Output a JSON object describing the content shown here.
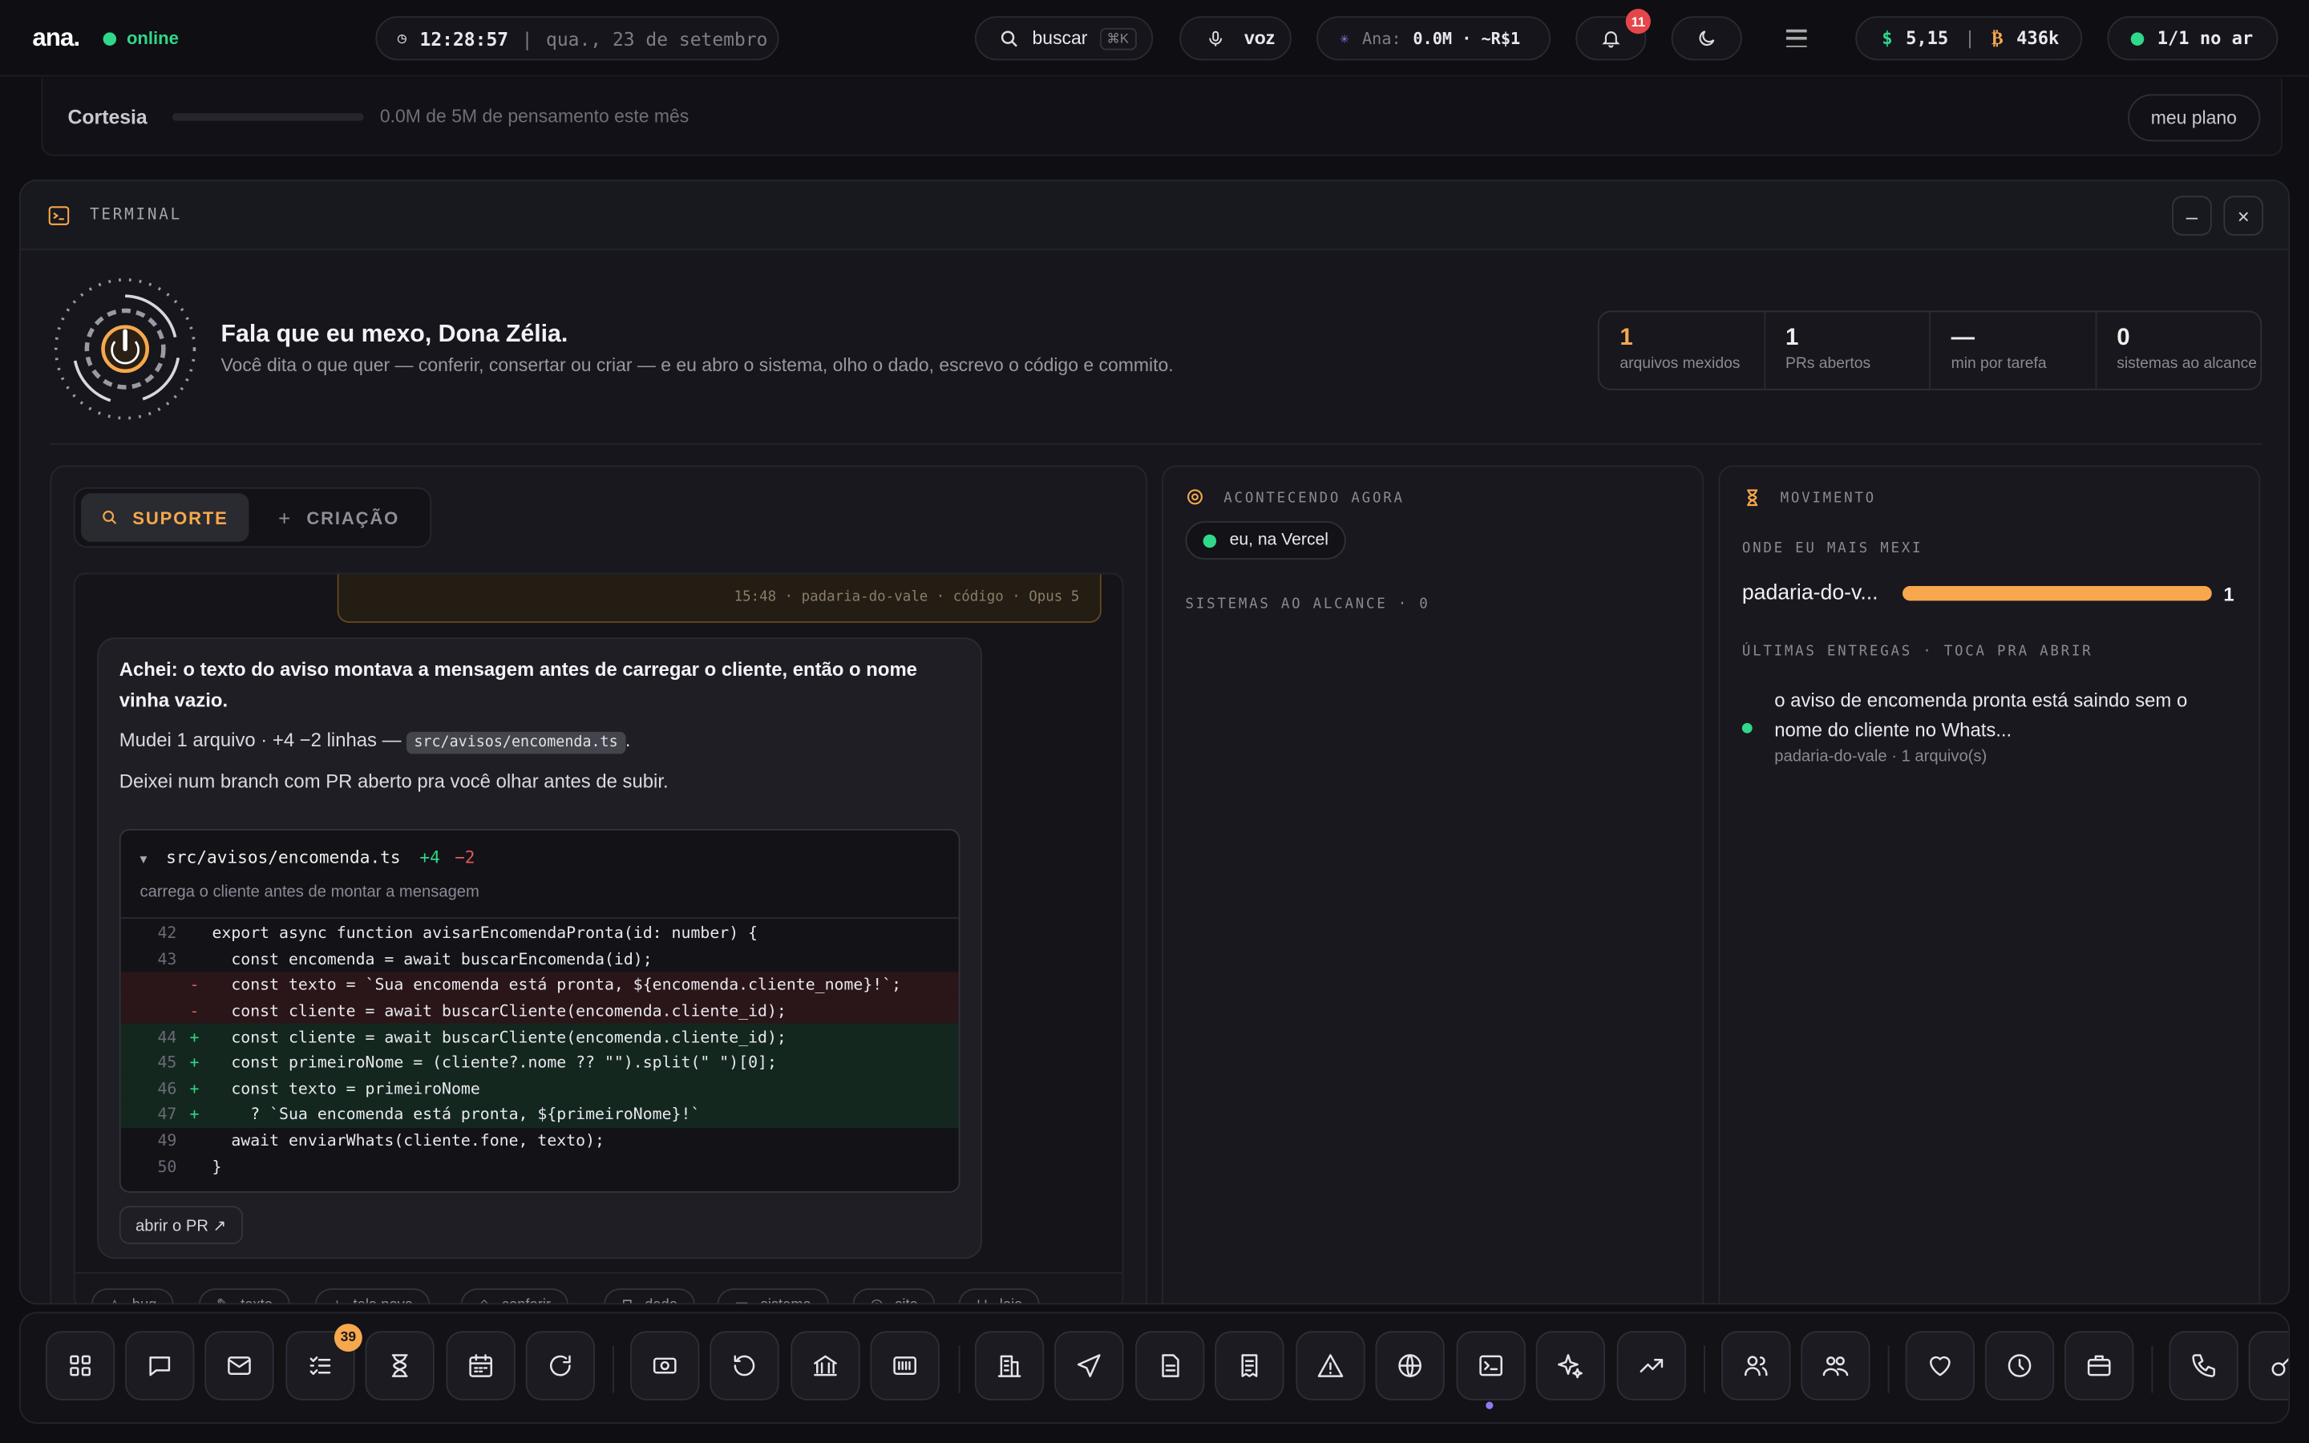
{
  "app": {
    "logo": "ana.",
    "status": "online"
  },
  "topbar": {
    "time": "12:28:57",
    "date_sep": "|",
    "date": "qua., 23 de setembro",
    "search_label": "buscar",
    "search_kbd": "⌘K",
    "voice_label": "voz",
    "usage_name": "Ana:",
    "usage_value": "0.0M · ~R$1",
    "notifications_count": "11",
    "balance_usd": "5,15",
    "balance_sep": "|",
    "balance_btc": "436k",
    "live_label": "1/1 no ar",
    "usd_symbol": "$",
    "btc_symbol": "₿"
  },
  "plan": {
    "name": "Cortesia",
    "usage_text": "0.0M de 5M de pensamento este mês",
    "usage_fraction": 0.0,
    "button": "meu plano"
  },
  "terminal": {
    "title": "TERMINAL",
    "minimize": "–",
    "close": "×",
    "hero_title": "Fala que eu mexo, Dona Zélia.",
    "hero_sub": "Você dita o que quer — conferir, consertar ou criar — e eu abro o sistema, olho o dado, escrevo o código e commito.",
    "stats": [
      {
        "value": "1",
        "label": "arquivos mexidos"
      },
      {
        "value": "1",
        "label": "PRs abertos"
      },
      {
        "value": "—",
        "label": "min por tarefa"
      },
      {
        "value": "0",
        "label": "sistemas ao alcance"
      }
    ],
    "tabs": {
      "support": "SUPORTE",
      "create": "CRIAÇÃO"
    },
    "prev_meta": "15:48 · padaria-do-vale · código · Opus 5",
    "reply": {
      "headline": "Achei: o texto do aviso montava a mensagem antes de carregar o cliente, então o nome vinha vazio.",
      "changed_prefix": "Mudei 1 arquivo · +4 −2 linhas —",
      "changed_file": "src/avisos/encomenda.ts",
      "changed_suffix": ".",
      "branch_note": "Deixei num branch com PR aberto pra você olhar antes de subir.",
      "diff": {
        "file": "src/avisos/encomenda.ts",
        "added": "+4",
        "removed": "−2",
        "description": "carrega o cliente antes de montar a mensagem",
        "lines": [
          {
            "n": "42",
            "s": "",
            "code": "export async function avisarEncomendaPronta(id: number) {",
            "kind": "ctx"
          },
          {
            "n": "43",
            "s": "",
            "code": "  const encomenda = await buscarEncomenda(id);",
            "kind": "ctx"
          },
          {
            "n": "",
            "s": "-",
            "code": "  const texto = `Sua encomenda está pronta, ${encomenda.cliente_nome}!`;",
            "kind": "del"
          },
          {
            "n": "",
            "s": "-",
            "code": "  const cliente = await buscarCliente(encomenda.cliente_id);",
            "kind": "del"
          },
          {
            "n": "44",
            "s": "+",
            "code": "  const cliente = await buscarCliente(encomenda.cliente_id);",
            "kind": "add"
          },
          {
            "n": "45",
            "s": "+",
            "code": "  const primeiroNome = (cliente?.nome ?? \"\").split(\" \")[0];",
            "kind": "add"
          },
          {
            "n": "46",
            "s": "+",
            "code": "  const texto = primeiroNome",
            "kind": "add"
          },
          {
            "n": "47",
            "s": "+",
            "code": "    ? `Sua encomenda está pronta, ${primeiroNome}!`",
            "kind": "add"
          },
          {
            "n": "49",
            "s": "",
            "code": "  await enviarWhats(cliente.fone, texto);",
            "kind": "ctx"
          },
          {
            "n": "50",
            "s": "",
            "code": "}",
            "kind": "ctx"
          }
        ]
      },
      "pr_button": "abrir o PR ↗"
    },
    "quick_chips": [
      "bug",
      "texto",
      "tela nova",
      "conferir",
      "dado",
      "sistema",
      "site",
      "loja"
    ],
    "now": {
      "title": "ACONTECENDO AGORA",
      "vercel": "eu, na Vercel",
      "systems": "SISTEMAS AO ALCANCE · 0"
    },
    "movement": {
      "title": "MOVIMENTO",
      "most_title": "ONDE EU MAIS MEXI",
      "most_name": "padaria-do-v...",
      "most_count": "1",
      "deliveries_title": "ÚLTIMAS ENTREGAS · TOCA PRA ABRIR",
      "delivery_text": "o aviso de encomenda pronta está saindo sem o nome do cliente no Whats...",
      "delivery_meta": "padaria-do-vale · 1 arquivo(s)"
    }
  },
  "dock": {
    "tasks_badge": "39",
    "icons": [
      "grid-icon",
      "chat-icon",
      "mail-icon",
      "tasks-icon",
      "hourglass-icon",
      "calendar-icon",
      "refresh-icon",
      "cash-icon",
      "history-icon",
      "bank-icon",
      "barcode-icon",
      "building-icon",
      "send-icon",
      "document-icon",
      "receipt-icon",
      "warning-icon",
      "globe-icon",
      "terminal-icon",
      "sparkle-icon",
      "chart-icon",
      "people-icon",
      "team-icon",
      "heart-icon",
      "clock-icon",
      "briefcase-icon",
      "phone-icon",
      "key-icon"
    ]
  },
  "colors": {
    "accent": "#f7a84c",
    "online": "#2fd88a",
    "danger": "#e4464a",
    "background": "#0e0e13"
  }
}
